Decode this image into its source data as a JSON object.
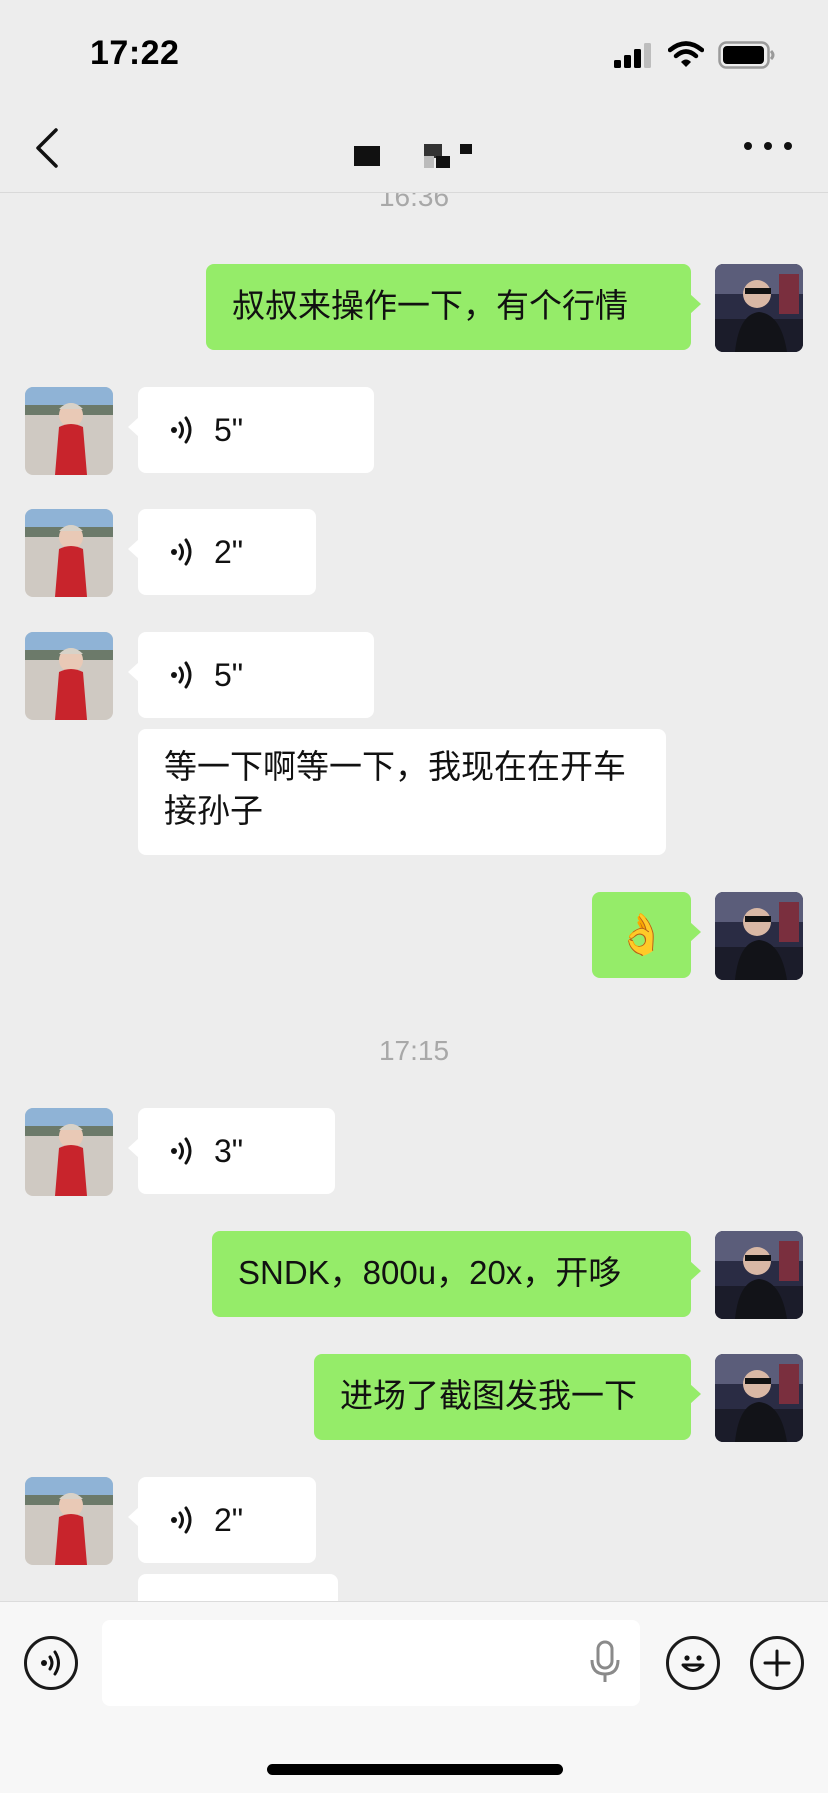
{
  "status_bar": {
    "time": "17:22"
  },
  "nav": {
    "title": ""
  },
  "messages": [
    {
      "type": "timestamp",
      "text": "16:36"
    },
    {
      "type": "text",
      "side": "out",
      "text": "叔叔来操作一下，有个行情"
    },
    {
      "type": "voice",
      "side": "in",
      "duration": "5\""
    },
    {
      "type": "voice",
      "side": "in",
      "duration": "2\""
    },
    {
      "type": "voice",
      "side": "in",
      "duration": "5\""
    },
    {
      "type": "text",
      "side": "in",
      "text": "等一下啊等一下，我现在在开车接孙子"
    },
    {
      "type": "emoji",
      "side": "out",
      "emoji": "👌"
    },
    {
      "type": "timestamp",
      "text": "17:15"
    },
    {
      "type": "voice",
      "side": "in",
      "duration": "3\""
    },
    {
      "type": "text",
      "side": "out",
      "text": "SNDK，800u，20x，开哆"
    },
    {
      "type": "text",
      "side": "out",
      "text": "进场了截图发我一下"
    },
    {
      "type": "voice",
      "side": "in",
      "duration": "2\""
    }
  ],
  "input_bar": {
    "placeholder": "",
    "icons": [
      "voice-mode-icon",
      "microphone-icon",
      "emoji-icon",
      "plus-icon"
    ]
  },
  "colors": {
    "outgoing_bubble": "#95ec69",
    "incoming_bubble": "#ffffff",
    "background": "#ededed"
  }
}
